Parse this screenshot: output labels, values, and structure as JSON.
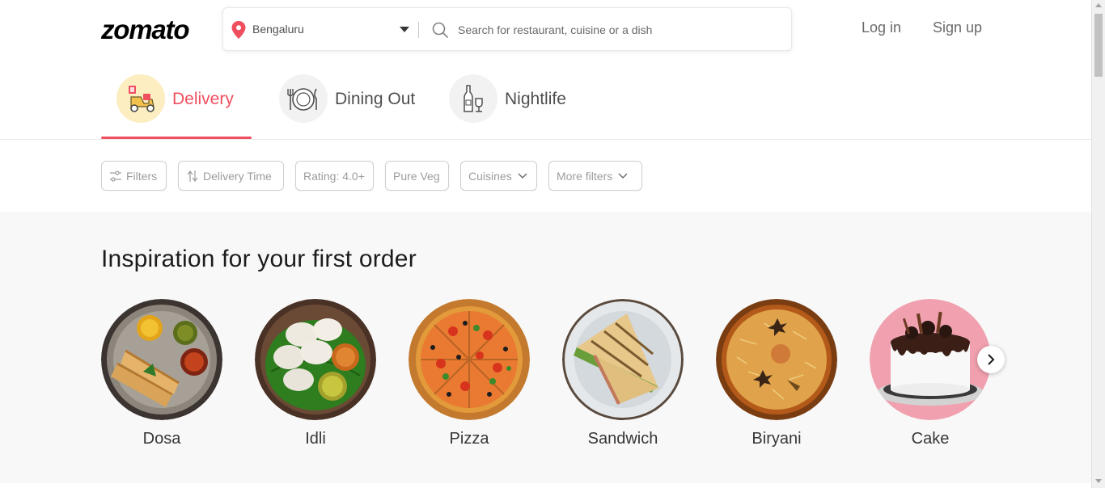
{
  "header": {
    "logo": "zomato",
    "location": "Bengaluru",
    "search_placeholder": "Search for restaurant, cuisine or a dish",
    "login": "Log in",
    "signup": "Sign up"
  },
  "tabs": [
    {
      "label": "Delivery",
      "icon": "delivery-scooter-icon",
      "active": true
    },
    {
      "label": "Dining Out",
      "icon": "dining-plate-icon",
      "active": false
    },
    {
      "label": "Nightlife",
      "icon": "nightlife-bottles-icon",
      "active": false
    }
  ],
  "filters": [
    {
      "label": "Filters",
      "icon": "sliders-icon"
    },
    {
      "label": "Delivery Time",
      "icon": "sort-arrows-icon"
    },
    {
      "label": "Rating: 4.0+"
    },
    {
      "label": "Pure Veg"
    },
    {
      "label": "Cuisines",
      "icon": "chevron-down-icon"
    },
    {
      "label": "More filters",
      "icon": "chevron-down-icon"
    }
  ],
  "inspiration": {
    "title": "Inspiration for your first order",
    "items": [
      {
        "label": "Dosa"
      },
      {
        "label": "Idli"
      },
      {
        "label": "Pizza"
      },
      {
        "label": "Sandwich"
      },
      {
        "label": "Biryani"
      },
      {
        "label": "Cake"
      }
    ],
    "next_icon": "chevron-right-icon"
  },
  "colors": {
    "accent": "#ef4f5f",
    "delivery_tab_bg": "#fceec0",
    "section_bg": "#f8f8f8"
  }
}
